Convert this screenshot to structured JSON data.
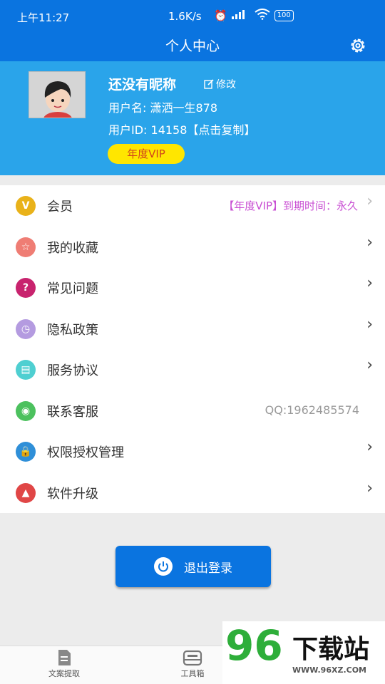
{
  "status": {
    "time": "上午11:27",
    "speed": "1.6K/s",
    "battery": "100"
  },
  "header": {
    "title": "个人中心"
  },
  "profile": {
    "nickname": "还没有昵称",
    "edit_label": "修改",
    "username": "用户名: 潇洒一生878",
    "userid": "用户ID: 14158【点击复制】",
    "vip_badge": "年度VIP"
  },
  "menu": [
    {
      "label": "会员",
      "icon": "v-icon",
      "color": "#e9b21a",
      "right": "【年度VIP】到期时间：永久"
    },
    {
      "label": "我的收藏",
      "icon": "star-icon",
      "color": "#ef7d74"
    },
    {
      "label": "常见问题",
      "icon": "question-icon",
      "color": "#c8236e"
    },
    {
      "label": "隐私政策",
      "icon": "clock-icon",
      "color": "#b49be0"
    },
    {
      "label": "服务协议",
      "icon": "document-icon",
      "color": "#4fcfd1"
    },
    {
      "label": "联系客服",
      "icon": "chat-icon",
      "color": "#4cc15e",
      "right": "QQ:1962485574"
    },
    {
      "label": "权限授权管理",
      "icon": "lock-icon",
      "color": "#2f8fd8"
    },
    {
      "label": "软件升级",
      "icon": "rocket-icon",
      "color": "#e04646"
    }
  ],
  "logout": {
    "label": "退出登录"
  },
  "tabs": [
    {
      "label": "文案提取"
    },
    {
      "label": "工具箱"
    }
  ],
  "watermark": {
    "number": "96",
    "text": "下载站",
    "url": "WWW.96XZ.COM"
  }
}
